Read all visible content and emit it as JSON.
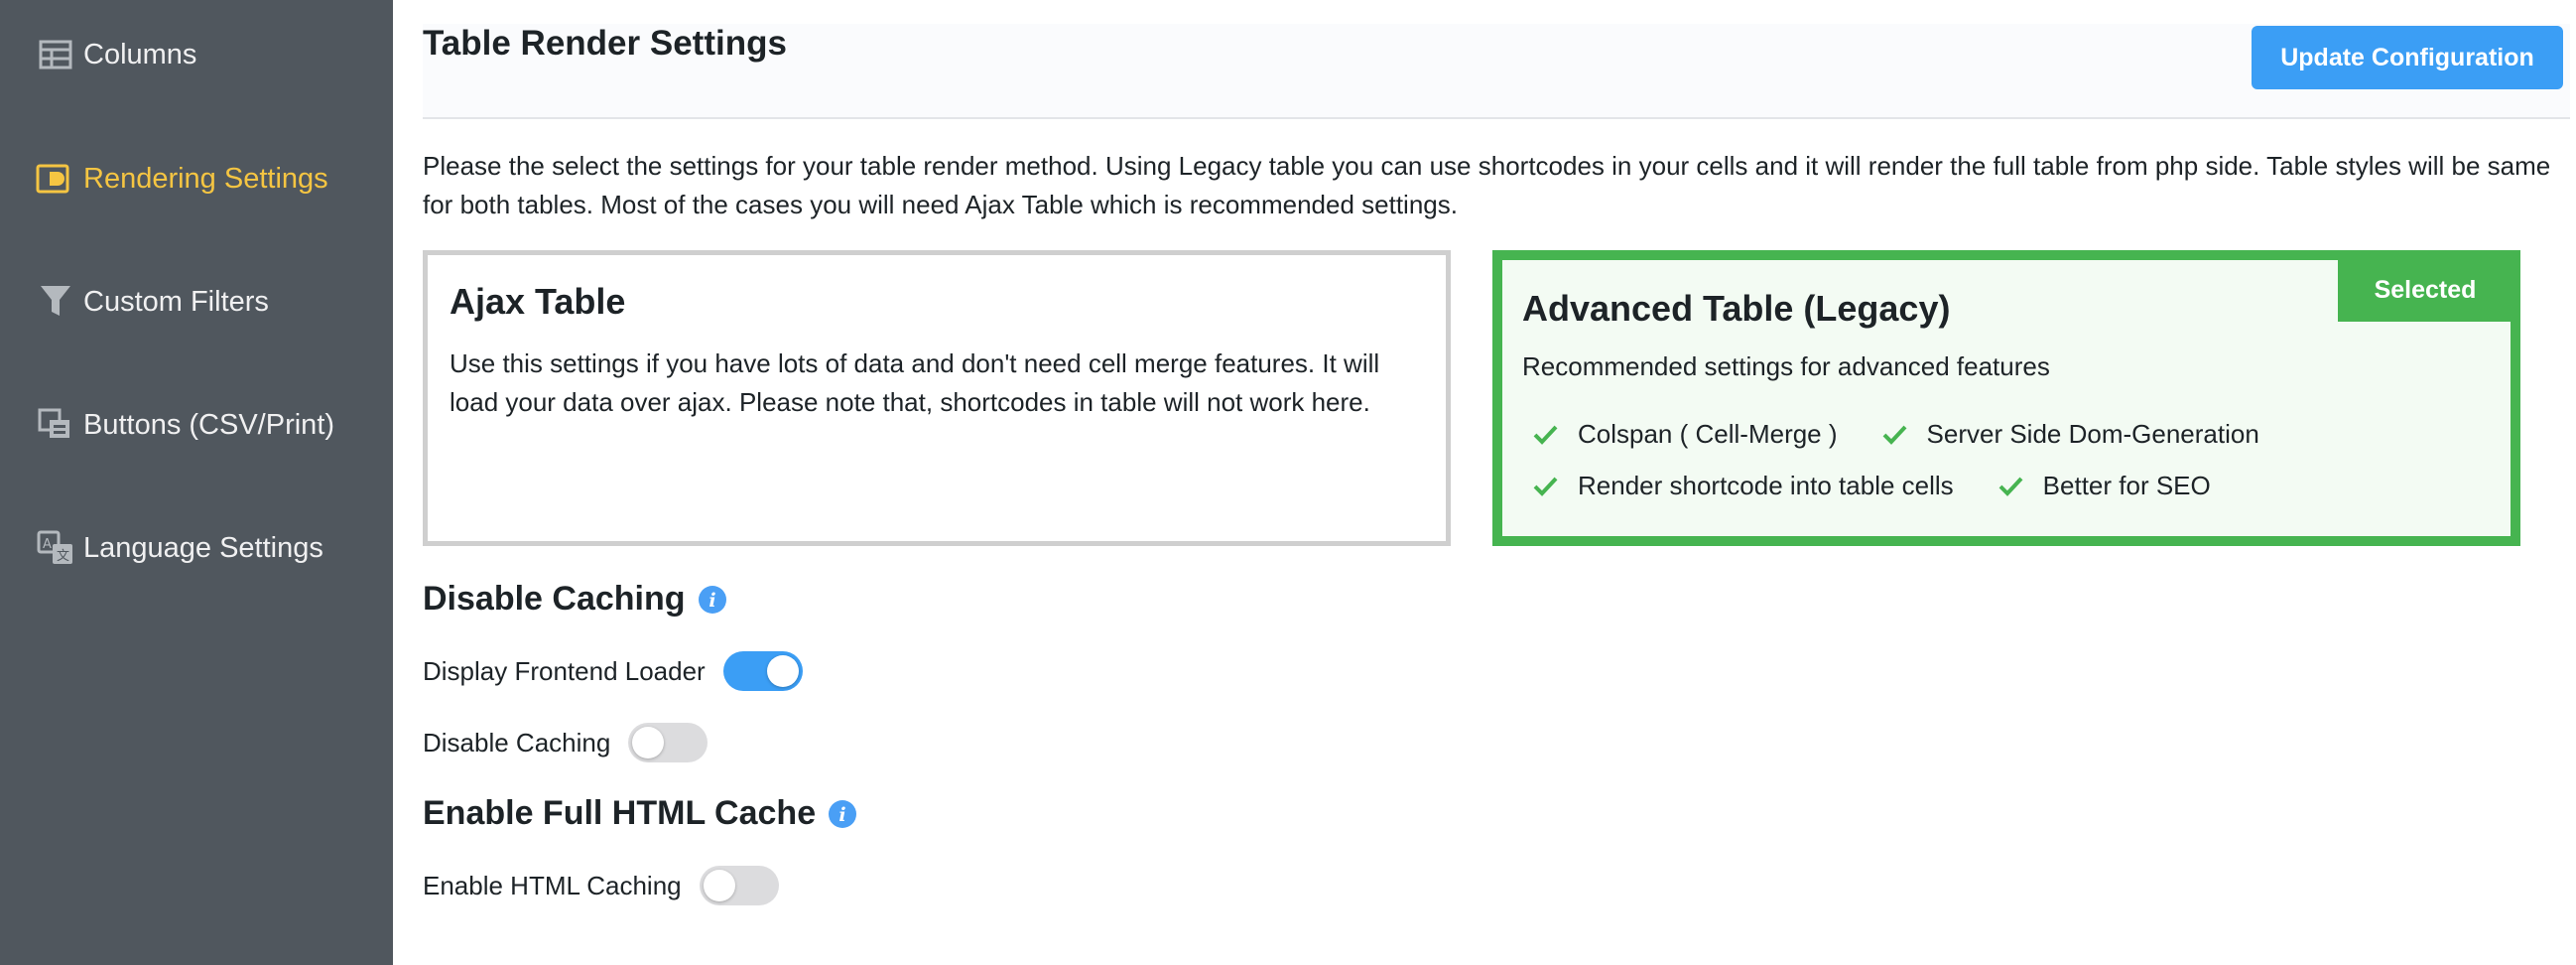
{
  "sidebar": {
    "items": [
      {
        "label": "Columns",
        "icon": "table-icon",
        "active": false
      },
      {
        "label": "Rendering Settings",
        "icon": "render-icon",
        "active": true
      },
      {
        "label": "Custom Filters",
        "icon": "filter-icon",
        "active": false
      },
      {
        "label": "Buttons (CSV/Print)",
        "icon": "buttons-icon",
        "active": false
      },
      {
        "label": "Language Settings",
        "icon": "language-icon",
        "active": false
      }
    ]
  },
  "header": {
    "title": "Table Render Settings",
    "update_button": "Update Configuration"
  },
  "intro_text": "Please the select the settings for your table render method. Using Legacy table you can use shortcodes in your cells and it will render the full table from php side. Table styles will be same for both tables. Most of the cases you will need Ajax Table which is recommended settings.",
  "render_options": {
    "ajax": {
      "title": "Ajax Table",
      "description": "Use this settings if you have lots of data and don't need cell merge features. It will load your data over ajax. Please note that, shortcodes in table will not work here.",
      "selected": false
    },
    "advanced": {
      "title": "Advanced Table (Legacy)",
      "description": "Recommended settings for advanced features",
      "badge": "Selected",
      "selected": true,
      "features": [
        "Colspan ( Cell-Merge )",
        "Server Side Dom-Generation",
        "Render shortcode into table cells",
        "Better for SEO"
      ]
    }
  },
  "caching": {
    "title": "Disable Caching",
    "options": [
      {
        "label": "Display Frontend Loader",
        "enabled": true
      },
      {
        "label": "Disable Caching",
        "enabled": false
      }
    ]
  },
  "html_cache": {
    "title": "Enable Full HTML Cache",
    "options": [
      {
        "label": "Enable HTML Caching",
        "enabled": false
      }
    ]
  },
  "colors": {
    "sidebar_bg": "#50575e",
    "active_text": "#f5c542",
    "primary": "#3b9ef5",
    "selected_green": "#46b450"
  }
}
